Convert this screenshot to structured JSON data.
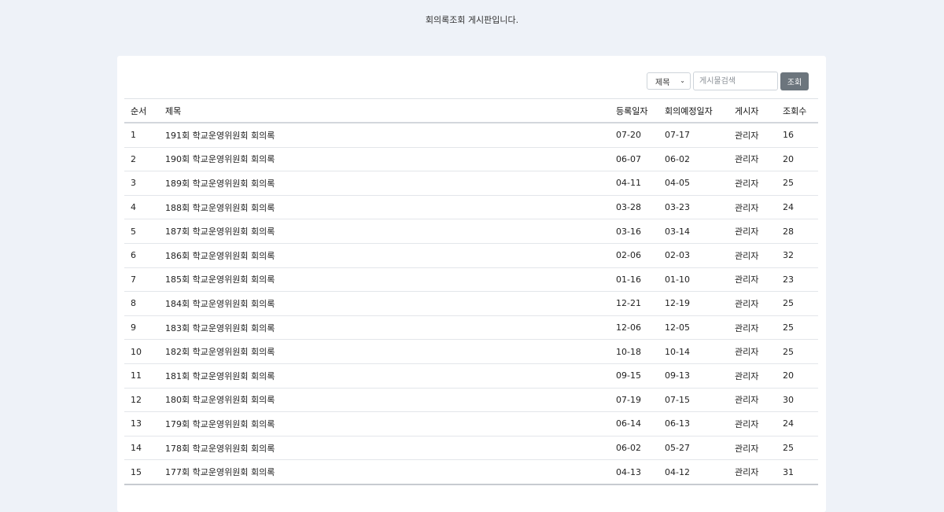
{
  "page": {
    "description": "회의록조회 게시판입니다."
  },
  "search": {
    "field_selected": "제목",
    "placeholder": "게시물검색",
    "button_label": "조회"
  },
  "table": {
    "headers": [
      "순서",
      "제목",
      "등록일자",
      "회의예정일자",
      "게시자",
      "조회수"
    ],
    "rows": [
      {
        "no": "1",
        "title": "191회 학교운영위원회 회의록",
        "reg": "07-20",
        "meeting": "07-17",
        "author": "관리자",
        "views": "16"
      },
      {
        "no": "2",
        "title": "190회 학교운영위원회 회의록",
        "reg": "06-07",
        "meeting": "06-02",
        "author": "관리자",
        "views": "20"
      },
      {
        "no": "3",
        "title": "189회 학교운영위원회 회의록",
        "reg": "04-11",
        "meeting": "04-05",
        "author": "관리자",
        "views": "25"
      },
      {
        "no": "4",
        "title": "188회 학교운영위원회 회의록",
        "reg": "03-28",
        "meeting": "03-23",
        "author": "관리자",
        "views": "24"
      },
      {
        "no": "5",
        "title": "187회 학교운영위원회 회의록",
        "reg": "03-16",
        "meeting": "03-14",
        "author": "관리자",
        "views": "28"
      },
      {
        "no": "6",
        "title": "186회 학교운영위원회 회의록",
        "reg": "02-06",
        "meeting": "02-03",
        "author": "관리자",
        "views": "32"
      },
      {
        "no": "7",
        "title": "185회 학교운영위원회 회의록",
        "reg": "01-16",
        "meeting": "01-10",
        "author": "관리자",
        "views": "23"
      },
      {
        "no": "8",
        "title": "184회 학교운영위원회 회의록",
        "reg": "12-21",
        "meeting": "12-19",
        "author": "관리자",
        "views": "25"
      },
      {
        "no": "9",
        "title": "183회 학교운영위원회 회의록",
        "reg": "12-06",
        "meeting": "12-05",
        "author": "관리자",
        "views": "25"
      },
      {
        "no": "10",
        "title": "182회 학교운영위원회 회의록",
        "reg": "10-18",
        "meeting": "10-14",
        "author": "관리자",
        "views": "25"
      },
      {
        "no": "11",
        "title": "181회 학교운영위원회 회의록",
        "reg": "09-15",
        "meeting": "09-13",
        "author": "관리자",
        "views": "20"
      },
      {
        "no": "12",
        "title": "180회 학교운영위원회 회의록",
        "reg": "07-19",
        "meeting": "07-15",
        "author": "관리자",
        "views": "30"
      },
      {
        "no": "13",
        "title": "179회 학교운영위원회 회의록",
        "reg": "06-14",
        "meeting": "06-13",
        "author": "관리자",
        "views": "24"
      },
      {
        "no": "14",
        "title": "178회 학교운영위원회 회의록",
        "reg": "06-02",
        "meeting": "05-27",
        "author": "관리자",
        "views": "25"
      },
      {
        "no": "15",
        "title": "177회 학교운영위원회 회의록",
        "reg": "04-13",
        "meeting": "04-12",
        "author": "관리자",
        "views": "31"
      }
    ]
  },
  "colors": {
    "page_background": "#eef2f8",
    "card_background": "#ffffff",
    "search_button": "#6c757d"
  }
}
